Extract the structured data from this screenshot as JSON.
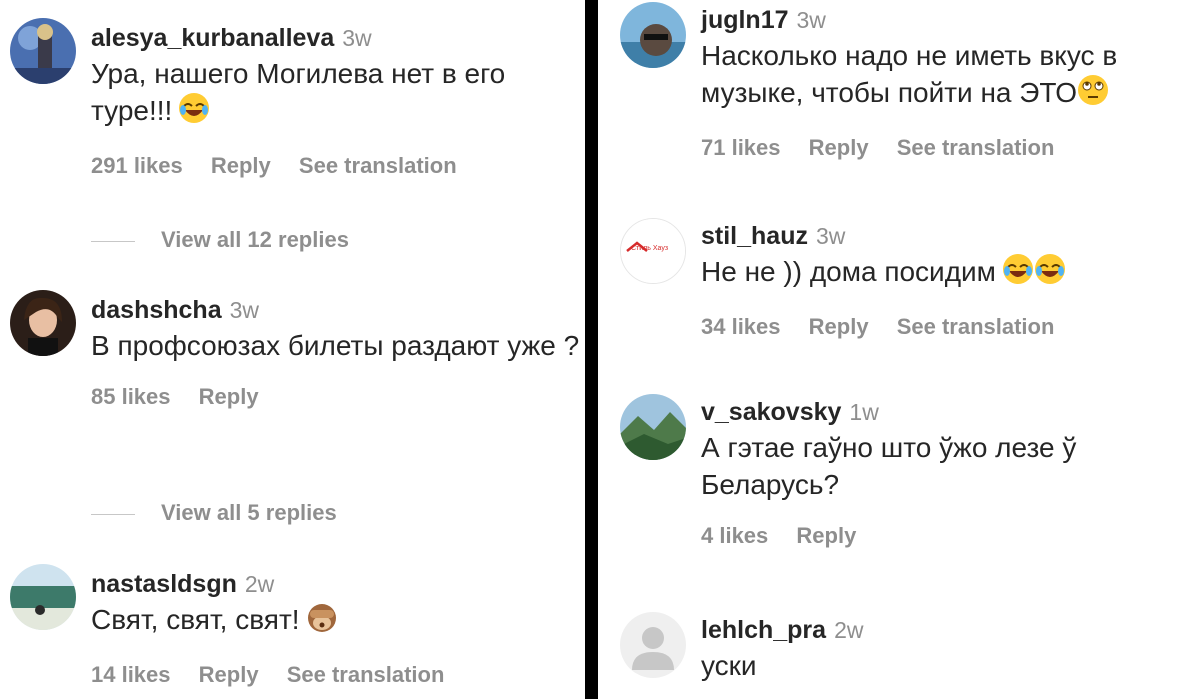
{
  "left_comments": [
    {
      "username": "alesya_kurbanalleva",
      "time": "3w",
      "text": "Ура, нашего Могилева нет в его туре!!!",
      "likes": "291 likes",
      "reply": "Reply",
      "translate": "See translation",
      "view_replies": "View all 12 replies",
      "emoji": "face-with-tears-of-joy"
    },
    {
      "username": "dashshcha",
      "time": "3w",
      "text": "В профсоюзах билеты раздают уже ?",
      "likes": "85 likes",
      "reply": "Reply",
      "view_replies": "View all 5 replies"
    },
    {
      "username": "nastasldsgn",
      "time": "2w",
      "text": "Свят, свят, свят!",
      "likes": "14 likes",
      "reply": "Reply",
      "translate": "See translation",
      "emoji": "see-no-evil-monkey"
    }
  ],
  "right_comments": [
    {
      "username": "jugln17",
      "time": "3w",
      "text": "Насколько надо не иметь вкус в музыке, чтобы пойти на ЭТО",
      "likes": "71 likes",
      "reply": "Reply",
      "translate": "See translation",
      "emoji": "face-with-rolling-eyes"
    },
    {
      "username": "stil_hauz",
      "time": "3w",
      "text": "Не не )) дома посидим",
      "likes": "34 likes",
      "reply": "Reply",
      "translate": "See translation",
      "avatar_text": "Стиль Хауз",
      "emoji": "face-with-tears-of-joy"
    },
    {
      "username": "v_sakovsky",
      "time": "1w",
      "text": "А гэтае гаўно што ўжо лезе ў Беларусь?",
      "likes": "4 likes",
      "reply": "Reply"
    },
    {
      "username": "lehlch_pra",
      "time": "2w",
      "text": "уски"
    }
  ],
  "colors": {
    "text": "#262626",
    "secondary": "#8e8e8e",
    "divider": "#000000",
    "background": "#ffffff"
  }
}
